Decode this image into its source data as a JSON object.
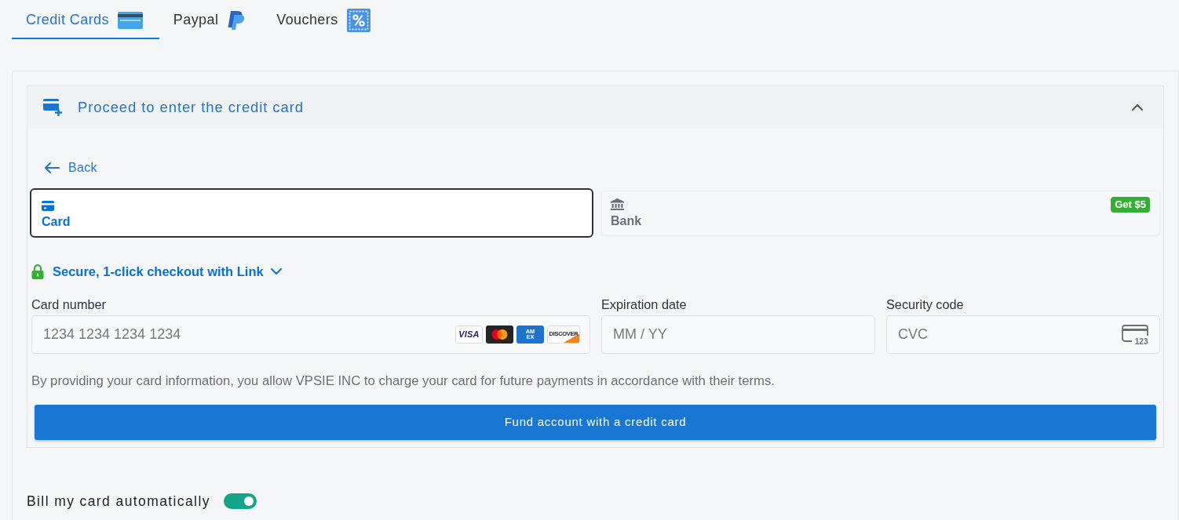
{
  "tabs": [
    {
      "kind": "credit_cards",
      "label": "Credit Cards",
      "selected": true
    },
    {
      "kind": "paypal",
      "label": "Paypal",
      "selected": false
    },
    {
      "kind": "vouchers",
      "label": "Vouchers",
      "selected": false
    }
  ],
  "accordion": {
    "title": "Proceed to enter the credit card",
    "expanded": true,
    "back_link": "Back",
    "payment_methods": [
      {
        "kind": "card",
        "label": "Card",
        "selected": true
      },
      {
        "kind": "bank",
        "label": "Bank",
        "selected": false,
        "badge": "Get $5"
      }
    ],
    "link_checkout": "Secure, 1-click checkout with Link",
    "fields": [
      {
        "label": "Card number",
        "placeholder": "1234 1234 1234 1234",
        "brands": [
          {
            "kind": "visa",
            "label": "VISA"
          },
          {
            "kind": "mastercard"
          },
          {
            "kind": "amex",
            "label": "AMEX"
          },
          {
            "kind": "discover",
            "label": "DISCOVER"
          }
        ]
      },
      {
        "label": "Expiration date",
        "placeholder": "MM / YY"
      },
      {
        "label": "Security code",
        "placeholder": "CVC",
        "icon_text": "123"
      }
    ],
    "terms": "By providing your card information, you allow VPSIE INC to charge your card for future payments in accordance with their terms.",
    "submit_button": "Fund account with a credit card"
  },
  "auto_billing": {
    "label": "Bill my card automatically",
    "on": true
  }
}
